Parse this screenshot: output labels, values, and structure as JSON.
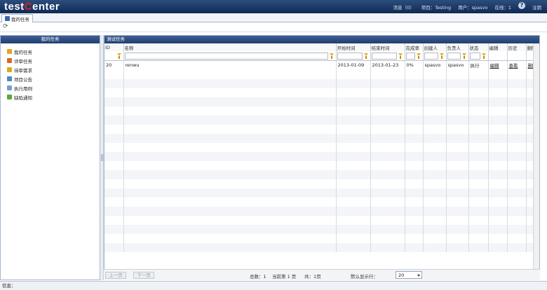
{
  "header": {
    "logo_prefix": "t",
    "logo_mid": "est",
    "logo_dot": "C",
    "logo_suffix": "enter",
    "messages": "消息（0）",
    "project": "项目：Testing",
    "user": "用户：spasvo",
    "online": "在线：1",
    "help_icon": "?",
    "logout": "注销"
  },
  "tab": {
    "label": "我的任务"
  },
  "left_panel": {
    "title": "我的任务",
    "items": [
      {
        "label": "我的任务",
        "icon": "folder-icon",
        "color": "#e0a820"
      },
      {
        "label": "评审任务",
        "icon": "review-icon",
        "color": "#d66a2a"
      },
      {
        "label": "待审需求",
        "icon": "requirement-icon",
        "color": "#e0a820"
      },
      {
        "label": "项目公告",
        "icon": "notice-icon",
        "color": "#4a8bc9"
      },
      {
        "label": "执行用例",
        "icon": "execute-icon",
        "color": "#7aa0c8"
      },
      {
        "label": "缺陷通知",
        "icon": "defect-icon",
        "color": "#5aa83a"
      }
    ]
  },
  "main_panel": {
    "title": "测试任务",
    "columns": [
      "ID",
      "名称",
      "开始时间",
      "结束时间",
      "完成率",
      "创建人",
      "负责人",
      "状态",
      "编辑",
      "历史",
      "删除"
    ],
    "rows": [
      {
        "id": "20",
        "name": "renwu",
        "start": "2013-01-09",
        "end": "2013-01-23",
        "progress": "0%",
        "creator": "spasvo",
        "owner": "spasvo",
        "status": "执行",
        "edit": "编辑",
        "history": "查看",
        "delete": "删除"
      }
    ]
  },
  "pager": {
    "first": "上一页",
    "next": "下一页",
    "total": "总数：1",
    "current": "当前第 1 页",
    "pages": "共：1页",
    "per_page_label": "默认显示行：",
    "per_page_value": "20"
  },
  "status_bar": {
    "text": "信息："
  }
}
